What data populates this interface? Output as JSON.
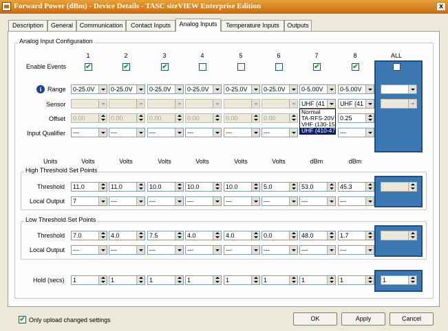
{
  "window": {
    "title": "Forward Power (dBm) - Device Details - TASC siteVIEW Enterprise Edition",
    "close_label": "x"
  },
  "tabs": [
    {
      "label": "Description"
    },
    {
      "label": "General"
    },
    {
      "label": "Communication"
    },
    {
      "label": "Contact Inputs"
    },
    {
      "label": "Analog Inputs",
      "active": true
    },
    {
      "label": "Temperature Inputs"
    },
    {
      "label": "Outputs"
    }
  ],
  "analog_config": {
    "title": "Analog Input Configuration",
    "columns": [
      "1",
      "2",
      "3",
      "4",
      "5",
      "6",
      "7",
      "8"
    ],
    "all_label": "ALL",
    "enable_events_label": "Enable Events",
    "enable_events": [
      true,
      true,
      true,
      false,
      false,
      false,
      true,
      true
    ],
    "enable_all": false,
    "range_label": "Range",
    "ranges": [
      "0-25.0V",
      "0-25.0V",
      "0-25.0V",
      "0-25.0V",
      "0-25.0V",
      "0-25.0V",
      "0-5.00V",
      "0-5.00V"
    ],
    "sensor_label": "Sensor",
    "sensors": [
      "",
      "",
      "",
      "",
      "",
      "",
      "UHF (41",
      "UHF (41"
    ],
    "offset_label": "Offset",
    "offsets": [
      "0.00",
      "0.00",
      "0.00",
      "0.00",
      "0.00",
      "0.00",
      "",
      "0.25"
    ],
    "input_qualifier_label": "Input Qualifier",
    "qualifiers": [
      "---",
      "---",
      "---",
      "---",
      "---",
      "---",
      "",
      "---"
    ],
    "sensor_dropdown": [
      "Normal",
      "TA-RFS-20V",
      "VHF (130-15",
      "UHF (410-47"
    ],
    "sensor_dropdown_selected": 3,
    "units_label": "Units",
    "units": [
      "Volts",
      "Volts",
      "Volts",
      "Volts",
      "Volts",
      "Volts",
      "dBm",
      "dBm"
    ]
  },
  "high_threshold": {
    "title": "High Threshold Set Points",
    "threshold_label": "Threshold",
    "thresholds": [
      "11.0",
      "11.0",
      "10.0",
      "10.0",
      "10.0",
      "5.0",
      "53.0",
      "45.3"
    ],
    "local_output_label": "Local Output",
    "outputs": [
      "7",
      "---",
      "---",
      "---",
      "---",
      "---",
      "---",
      "---"
    ]
  },
  "low_threshold": {
    "title": "Low Threshold Set Points",
    "threshold_label": "Threshold",
    "thresholds": [
      "7.0",
      "4.0",
      "7.5",
      "4.0",
      "4.0",
      "0.0",
      "48.0",
      "1.7"
    ],
    "local_output_label": "Local Output",
    "outputs": [
      "---",
      "---",
      "---",
      "---",
      "---",
      "---",
      "---",
      "---"
    ]
  },
  "hold": {
    "label": "Hold (secs)",
    "values": [
      "1",
      "1",
      "1",
      "1",
      "1",
      "1",
      "1",
      "1"
    ],
    "all_value": "1"
  },
  "footer": {
    "only_upload_label": "Only upload changed settings",
    "only_upload_checked": true,
    "ok_label": "OK",
    "apply_label": "Apply",
    "cancel_label": "Cancel"
  }
}
